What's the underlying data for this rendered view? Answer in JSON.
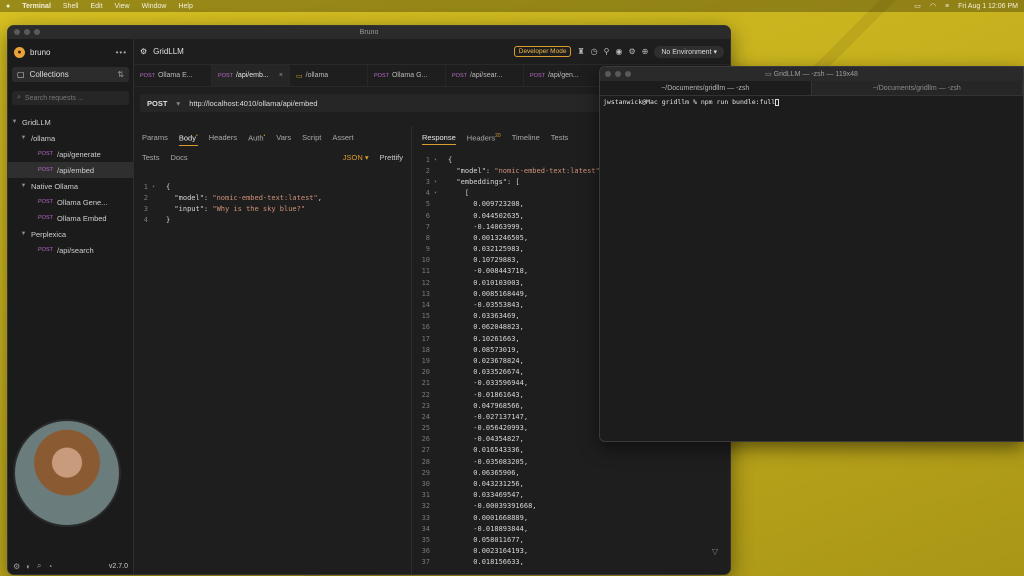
{
  "menubar": {
    "app": "Terminal",
    "items": [
      "Shell",
      "Edit",
      "View",
      "Window",
      "Help"
    ],
    "clock": "Fri Aug 1  12:06 PM"
  },
  "bruno": {
    "window_title": "Bruno",
    "sidebar": {
      "app_name": "bruno",
      "collections_label": "Collections",
      "search_placeholder": "Search requests ...",
      "version": "v2.7.0",
      "tree": [
        {
          "label": "GridLLM",
          "level": 0,
          "type": "collection"
        },
        {
          "label": "/ollama",
          "level": 1,
          "type": "folder"
        },
        {
          "label": "/api/generate",
          "level": 2,
          "method": "POST"
        },
        {
          "label": "/api/embed",
          "level": 2,
          "method": "POST",
          "active": true
        },
        {
          "label": "Native Ollama",
          "level": 1,
          "type": "folder"
        },
        {
          "label": "Ollama Gene...",
          "level": 2,
          "method": "POST"
        },
        {
          "label": "Ollama Embed",
          "level": 2,
          "method": "POST"
        },
        {
          "label": "Perplexica",
          "level": 1,
          "type": "folder"
        },
        {
          "label": "/api/search",
          "level": 2,
          "method": "POST"
        }
      ]
    },
    "topbar": {
      "collection": "GridLLM",
      "dev_mode": "Developer Mode",
      "environment": "No Environment"
    },
    "tabs": [
      {
        "method": "POST",
        "label": "Ollama E..."
      },
      {
        "method": "POST",
        "label": "/api/emb...",
        "active": true
      },
      {
        "method": "",
        "label": "/ollama",
        "folder": true
      },
      {
        "method": "POST",
        "label": "Ollama G..."
      },
      {
        "method": "POST",
        "label": "/api/sear..."
      },
      {
        "method": "POST",
        "label": "/api/gen..."
      }
    ],
    "url": {
      "method": "POST",
      "value": "http://localhost:4010/ollama/api/embed"
    },
    "request": {
      "tabs": [
        "Params",
        "Body",
        "Headers",
        "Auth",
        "Vars",
        "Script",
        "Assert"
      ],
      "tabs2": [
        "Tests",
        "Docs"
      ],
      "body_mode": "JSON",
      "prettify": "Prettify",
      "body_lines": [
        "{",
        "  \"model\": \"nomic-embed-text:latest\",",
        "  \"input\": \"Why is the sky blue?\"",
        "}"
      ]
    },
    "response": {
      "tabs": [
        "Response",
        "Headers",
        "Timeline",
        "Tests"
      ],
      "headers_count": "20",
      "lines": [
        "{",
        "  \"model\": \"nomic-embed-text:latest\",",
        "  \"embeddings\": [",
        "    [",
        "      0.009723208,",
        "      0.044502635,",
        "      -0.14063999,",
        "      0.0013246505,",
        "      0.032125983,",
        "      0.10729883,",
        "      -0.008443718,",
        "      0.010103003,",
        "      0.0085168449,",
        "      -0.03553843,",
        "      0.03363469,",
        "      0.062048823,",
        "      0.10261663,",
        "      0.08573019,",
        "      0.023678824,",
        "      0.033526674,",
        "      -0.033596944,",
        "      -0.01861643,",
        "      0.047968566,",
        "      -0.027137147,",
        "      -0.056420993,",
        "      -0.04354827,",
        "      0.016543336,",
        "      -0.035083205,",
        "      0.06365906,",
        "      0.043231256,",
        "      0.033469547,",
        "      -0.00039391668,",
        "      0.0001668889,",
        "      -0.018893844,",
        "      0.058011677,",
        "      0.0023164193,",
        "      0.018156633,"
      ]
    }
  },
  "terminal": {
    "title": "GridLLM — -zsh — 119x48",
    "tabs": [
      "~/Documents/gridllm — -zsh",
      "~/Documents/gridllm — -zsh"
    ],
    "prompt": "jwstanwick@Mac gridllm % npm run bundle:full"
  }
}
